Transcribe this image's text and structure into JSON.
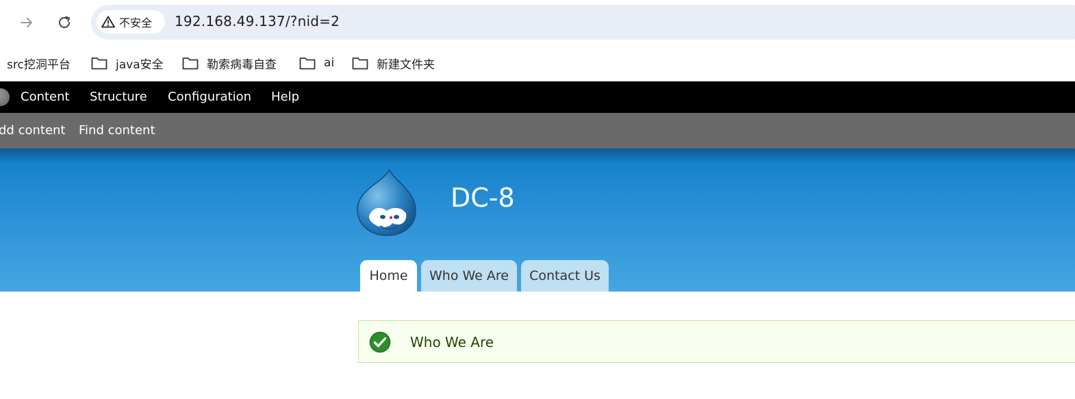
{
  "browser": {
    "security_label": "不安全",
    "url": "192.168.49.137/?nid=2",
    "icons": [
      "forward-arrow-icon",
      "reload-icon",
      "warning-triangle-icon"
    ]
  },
  "bookmarks": [
    {
      "label": "src挖洞平台",
      "icon": ""
    },
    {
      "label": "java安全",
      "icon": "folder-icon"
    },
    {
      "label": "勒索病毒自查",
      "icon": "folder-icon"
    },
    {
      "label": "ai",
      "icon": "folder-icon"
    },
    {
      "label": "新建文件夹",
      "icon": "folder-icon"
    }
  ],
  "toolbar": {
    "items": [
      "Content",
      "Structure",
      "Configuration",
      "Help"
    ]
  },
  "shortcuts": {
    "items": [
      "dd content",
      "Find content"
    ]
  },
  "site": {
    "name": "DC-8",
    "tabs": [
      {
        "label": "Home",
        "active": true
      },
      {
        "label": "Who We Are",
        "active": false
      },
      {
        "label": "Contact Us",
        "active": false
      }
    ]
  },
  "message": {
    "text": "Who We Are",
    "type": "status"
  },
  "colors": {
    "toolbar": "#000000",
    "shortcut_bar": "#6a6a6a",
    "header_blue": "#2a90d6",
    "tab_inactive": "#bfdff3",
    "message_bg": "#f8fff0",
    "message_border": "#bee59f",
    "message_text": "#234600"
  }
}
